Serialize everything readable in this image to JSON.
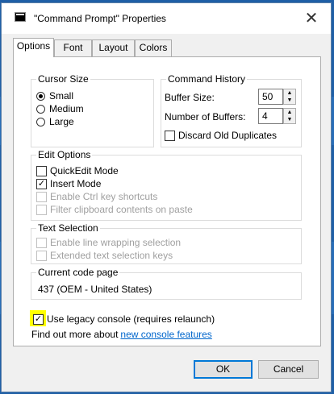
{
  "window": {
    "title": "\"Command Prompt\" Properties",
    "close_glyph": "✕"
  },
  "tabs": [
    {
      "label": "Options",
      "active": true
    },
    {
      "label": "Font"
    },
    {
      "label": "Layout"
    },
    {
      "label": "Colors"
    }
  ],
  "cursor_size": {
    "label": "Cursor Size",
    "options": [
      {
        "label": "Small",
        "selected": true
      },
      {
        "label": "Medium"
      },
      {
        "label": "Large"
      }
    ]
  },
  "command_history": {
    "label": "Command History",
    "buffer_size_label": "Buffer Size:",
    "buffer_size_value": "50",
    "num_buffers_label": "Number of Buffers:",
    "num_buffers_value": "4",
    "discard_label": "Discard Old Duplicates",
    "discard_checked": false
  },
  "edit_options": {
    "label": "Edit Options",
    "items": [
      {
        "label": "QuickEdit Mode",
        "checked": false,
        "enabled": true
      },
      {
        "label": "Insert Mode",
        "checked": true,
        "enabled": true
      },
      {
        "label": "Enable Ctrl key shortcuts",
        "checked": false,
        "enabled": false
      },
      {
        "label": "Filter clipboard contents on paste",
        "checked": false,
        "enabled": false
      }
    ]
  },
  "text_selection": {
    "label": "Text Selection",
    "items": [
      {
        "label": "Enable line wrapping selection",
        "enabled": false
      },
      {
        "label": "Extended text selection keys",
        "enabled": false
      }
    ]
  },
  "code_page": {
    "label": "Current code page",
    "value": "437   (OEM - United States)"
  },
  "legacy": {
    "label": "Use legacy console (requires relaunch)",
    "checked": true
  },
  "find_out": {
    "prefix": "Find out more about ",
    "link": "new console features"
  },
  "buttons": {
    "ok": "OK",
    "cancel": "Cancel"
  },
  "colors": {
    "accent": "#0078d7",
    "link": "#0066cc",
    "highlight": "#ffff00"
  },
  "icons": {
    "checkmark": "✓",
    "spin_up": "▲",
    "spin_down": "▼"
  }
}
